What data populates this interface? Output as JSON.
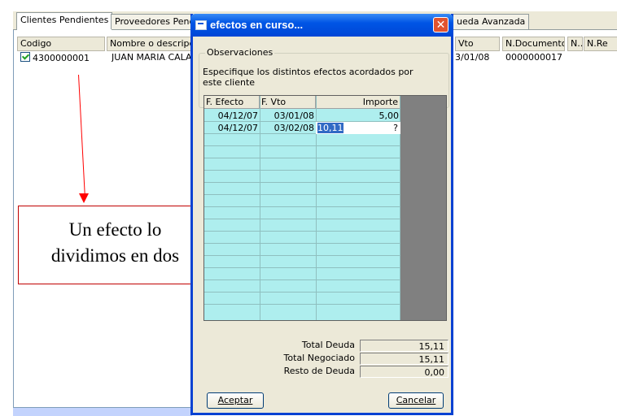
{
  "tabs": [
    {
      "label": "Clientes Pendientes"
    },
    {
      "label": "Proveedores Pendi"
    },
    {
      "label": "ueda Avanzada"
    }
  ],
  "background_grid": {
    "headers": [
      "Codigo",
      "Nombre o descripc",
      "Vto",
      "N.Documento",
      "N..",
      "N.Re"
    ],
    "row": {
      "codigo": "4300000001",
      "nombre": "JUAN MARIA CALA",
      "vto": "3/01/08",
      "documento": "0000000017"
    }
  },
  "annotation": {
    "line1": "Un efecto lo",
    "line2": "dividimos en dos",
    "color": "#ff0000"
  },
  "dialog": {
    "title": "efectos en curso...",
    "close_glyph": "✕",
    "group_label": "Observaciones",
    "description": "Especifique los distintos efectos acordados por este cliente",
    "columns": [
      "F. Efecto",
      "F. Vto",
      "Importe"
    ],
    "rows": [
      {
        "efecto": "04/12/07",
        "vto": "03/01/08",
        "importe": "5,00"
      },
      {
        "efecto": "04/12/07",
        "vto": "03/02/08",
        "importe": "10,11",
        "suffix": "?"
      }
    ],
    "totals": [
      {
        "label": "Total Deuda",
        "value": "15,11"
      },
      {
        "label": "Total Negociado",
        "value": "15,11"
      },
      {
        "label": "Resto de Deuda",
        "value": "0,00"
      }
    ],
    "accept_label": "Aceptar",
    "cancel_label": "Cancelar",
    "title_color": "#0055e5"
  }
}
